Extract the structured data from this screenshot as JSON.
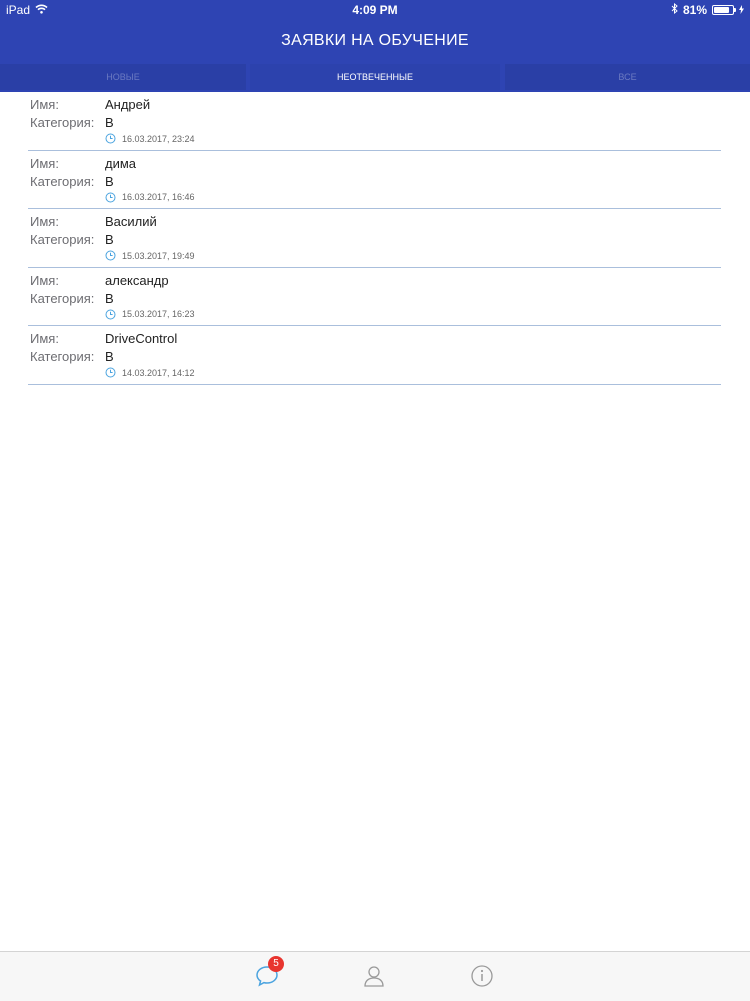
{
  "status_bar": {
    "device": "iPad",
    "time": "4:09 PM",
    "battery": "81%",
    "battery_level": 0.81
  },
  "header": {
    "title": "ЗАЯВКИ НА ОБУЧЕНИЕ"
  },
  "tabs": [
    {
      "label": "НОВЫЕ",
      "active": false
    },
    {
      "label": "НЕОТВЕЧЕННЫЕ",
      "active": true
    },
    {
      "label": "ВСЕ",
      "active": false
    }
  ],
  "list": {
    "name_label": "Имя:",
    "category_label": "Категория:",
    "items": [
      {
        "name": "Андрей",
        "category": "B",
        "date": "16.03.2017, 23:24"
      },
      {
        "name": "дима",
        "category": "B",
        "date": "16.03.2017, 16:46"
      },
      {
        "name": "Василий",
        "category": "B",
        "date": "15.03.2017, 19:49"
      },
      {
        "name": "александр",
        "category": "B",
        "date": "15.03.2017, 16:23"
      },
      {
        "name": "DriveControl",
        "category": "B",
        "date": "14.03.2017, 14:12"
      }
    ]
  },
  "tab_bar": {
    "items": [
      {
        "icon": "chat-bubble-icon",
        "badge": "5",
        "active": true
      },
      {
        "icon": "user-icon",
        "active": false
      },
      {
        "icon": "info-icon",
        "active": false
      }
    ]
  },
  "colors": {
    "primary": "#2e44b3",
    "accent": "#4aa3df",
    "badge": "#e8352f",
    "divider": "#aabfdc"
  }
}
